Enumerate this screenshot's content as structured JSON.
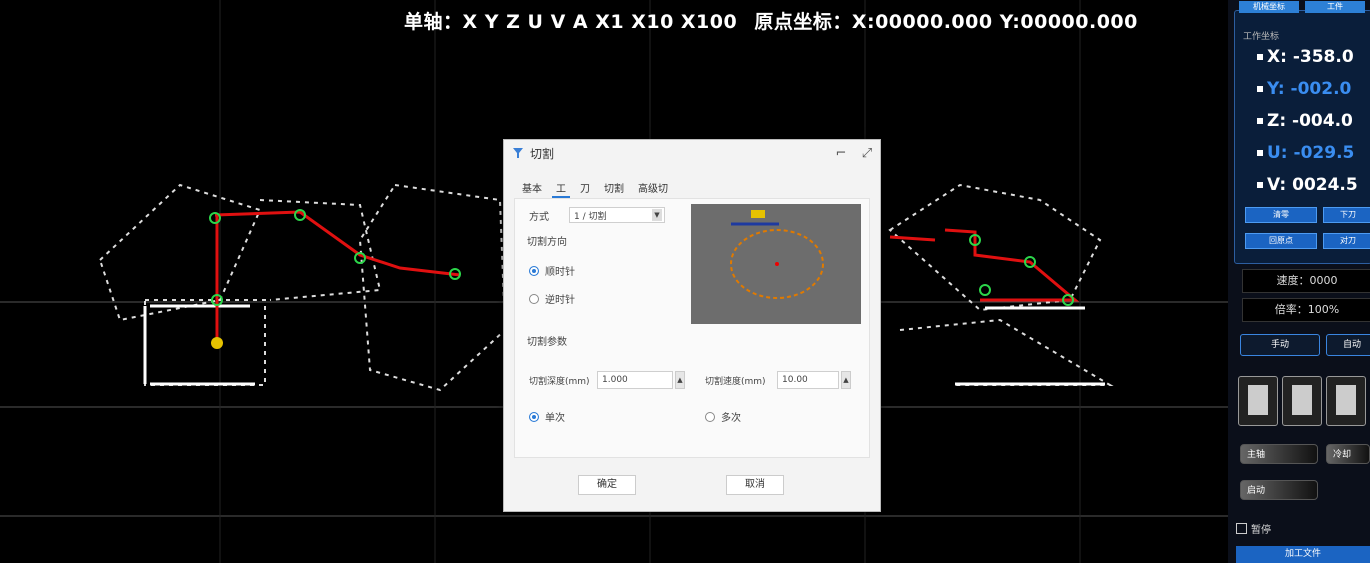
{
  "canvas": {
    "axis_text": "单轴：X Y Z U V A X1 X10 X100",
    "coord_text": "原点坐标：X:00000.000 Y:00000.000"
  },
  "dialog": {
    "title": "切割",
    "tabs": [
      "基本",
      "工",
      "刀",
      "切割",
      "高级切"
    ],
    "mode_label": "方式",
    "mode_value": "1 / 切割",
    "group1_label": "切割方向",
    "radio1_label": "顺时针",
    "radio2_label": "逆时针",
    "group2_label": "切割参数",
    "param1_label": "切割深度(mm)",
    "param1_value": "1.000",
    "param2_label": "切割速度(mm)",
    "param2_value": "10.00",
    "radio3_label": "单次",
    "radio4_label": "多次",
    "ok_label": "确定",
    "cancel_label": "取消"
  },
  "panel": {
    "header_btn1": "机械坐标",
    "header_btn2": "工件",
    "axis_caption": "工作坐标",
    "axes": [
      {
        "label": "X: -358.0",
        "color": "#ffffff"
      },
      {
        "label": "Y: -002.0",
        "color": "#3a8df0"
      },
      {
        "label": "Z: -004.0",
        "color": "#ffffff"
      },
      {
        "label": "U: -029.5",
        "color": "#3a8df0"
      },
      {
        "label": "V: 0024.5",
        "color": "#ffffff"
      }
    ],
    "btn_a": "清零",
    "btn_b": "下刀",
    "btn_c": "回原点",
    "btn_d": "对刀",
    "field1": "速度：0000",
    "field2": "倍率：100%",
    "seg_btn1": "手动",
    "seg_btn2": "自动",
    "pill1": "主轴",
    "pill2": "冷却",
    "pill3": "启动",
    "checkbox_label": "暂停",
    "bottom_label": "加工文件"
  }
}
